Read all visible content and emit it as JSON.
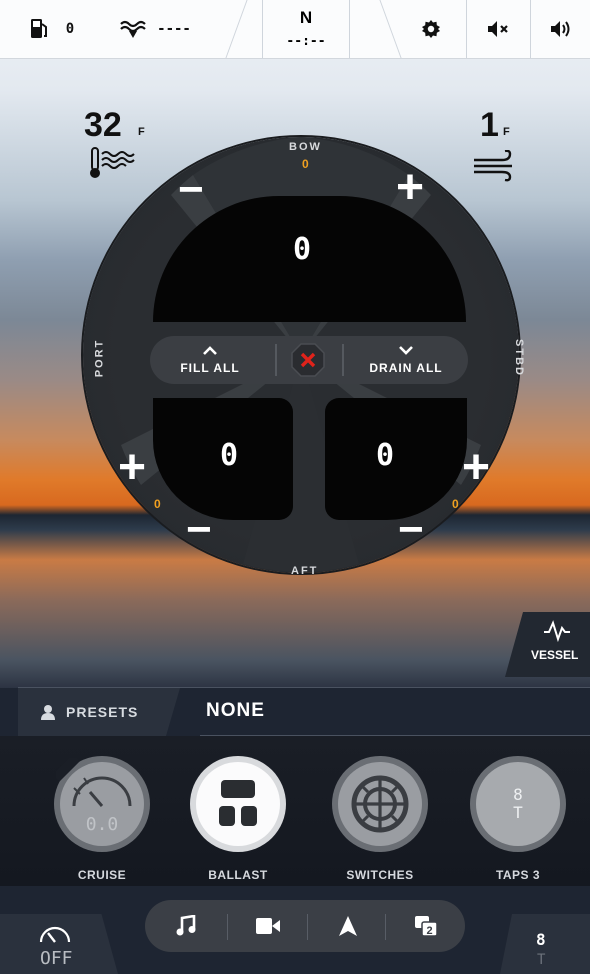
{
  "topbar": {
    "fuel_value": "0",
    "depth_value": "----",
    "heading": "N",
    "time": "--:--"
  },
  "conditions": {
    "water_temp": "32",
    "water_temp_unit": "F",
    "wind_speed": "1",
    "wind_unit": "F"
  },
  "ballast": {
    "bow_label": "BOW",
    "bow_level": "0",
    "aft_label": "AFT",
    "port_label": "PORT",
    "stbd_label": "STBD",
    "center_value": "0",
    "port_value": "0",
    "stbd_value": "0",
    "port_level": "0",
    "stbd_level": "0",
    "fill_all_label": "FILL ALL",
    "drain_all_label": "DRAIN ALL",
    "minus": "−",
    "plus": "+"
  },
  "vessel": {
    "label": "VESSEL"
  },
  "presets": {
    "label": "PRESETS",
    "value": "NONE"
  },
  "apps": [
    {
      "name": "CRUISE",
      "display": "0.0"
    },
    {
      "name": "BALLAST"
    },
    {
      "name": "SWITCHES"
    },
    {
      "name": "TAPS 3",
      "display_top": "8",
      "display_bottom": "T"
    }
  ],
  "corners": {
    "left_label": "OFF",
    "right_top": "8",
    "right_bottom": "T"
  },
  "colors": {
    "accent_orange": "#f0a020",
    "alert_red": "#e0231b",
    "panel_dark": "#050505"
  }
}
